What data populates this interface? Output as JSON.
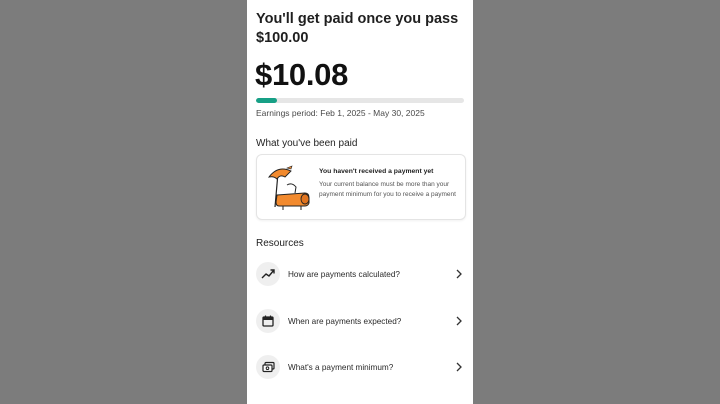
{
  "header": {
    "headline_line1": "You'll get paid once you pass",
    "headline_line2": "$100.00"
  },
  "balance": {
    "amount": "$10.08",
    "progress_fraction": 0.1008,
    "progress_color": "#17a086",
    "earnings_period": "Earnings period: Feb 1, 2025 - May 30, 2025"
  },
  "paid_section": {
    "title": "What you've been paid",
    "card": {
      "illustration": "deck-chair-umbrella-illustration",
      "title": "You haven't received a payment yet",
      "description": "Your current balance must be more than your payment minimum for you to receive a payment"
    }
  },
  "resources": {
    "title": "Resources",
    "items": [
      {
        "label": "How are payments calculated?",
        "icon": "trending-up-icon"
      },
      {
        "label": "When are payments expected?",
        "icon": "calendar-icon"
      },
      {
        "label": "What's a payment minimum?",
        "icon": "payment-card-icon"
      }
    ]
  },
  "colors": {
    "accent": "#17a086",
    "illustration_orange": "#f28a2e"
  }
}
